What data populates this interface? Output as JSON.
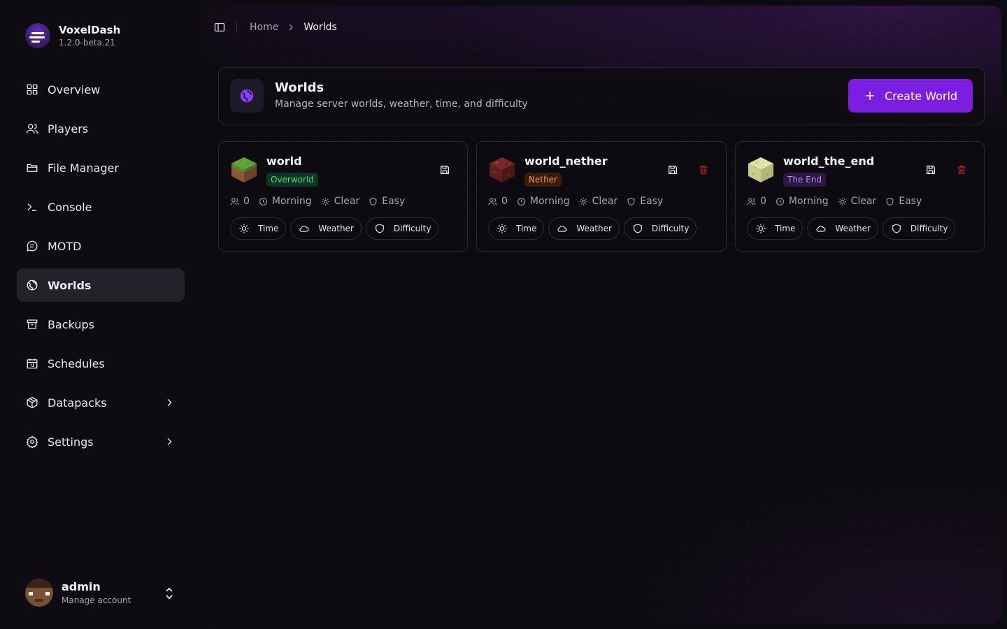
{
  "brand": {
    "name": "VoxelDash",
    "version": "1.2.0-beta.21"
  },
  "sidebar": {
    "items": [
      {
        "label": "Overview",
        "icon": "grid-icon"
      },
      {
        "label": "Players",
        "icon": "users-icon"
      },
      {
        "label": "File Manager",
        "icon": "folder-icon"
      },
      {
        "label": "Console",
        "icon": "terminal-icon"
      },
      {
        "label": "MOTD",
        "icon": "message-icon"
      },
      {
        "label": "Worlds",
        "icon": "globe-icon",
        "active": true
      },
      {
        "label": "Backups",
        "icon": "archive-icon"
      },
      {
        "label": "Schedules",
        "icon": "calendar-icon"
      },
      {
        "label": "Datapacks",
        "icon": "package-icon",
        "expandable": true
      },
      {
        "label": "Settings",
        "icon": "gear-icon",
        "expandable": true
      }
    ]
  },
  "user": {
    "name": "admin",
    "subtitle": "Manage account"
  },
  "breadcrumb": {
    "home": "Home",
    "current": "Worlds"
  },
  "header": {
    "title": "Worlds",
    "subtitle": "Manage server worlds, weather, time, and difficulty",
    "create_label": "Create World"
  },
  "worlds": [
    {
      "name": "world",
      "dimension": "Overworld",
      "players": "0",
      "time": "Morning",
      "weather": "Clear",
      "difficulty": "Easy"
    },
    {
      "name": "world_nether",
      "dimension": "Nether",
      "players": "0",
      "time": "Morning",
      "weather": "Clear",
      "difficulty": "Easy"
    },
    {
      "name": "world_the_end",
      "dimension": "The End",
      "players": "0",
      "time": "Morning",
      "weather": "Clear",
      "difficulty": "Easy"
    }
  ],
  "world_actions": {
    "time": "Time",
    "weather": "Weather",
    "difficulty": "Difficulty"
  },
  "colors": {
    "accent": "#7c1de2",
    "overworld_badge_text": "#4ade80",
    "nether_badge_text": "#fb923c",
    "end_badge_text": "#c084fc",
    "delete": "#b91c1c"
  }
}
